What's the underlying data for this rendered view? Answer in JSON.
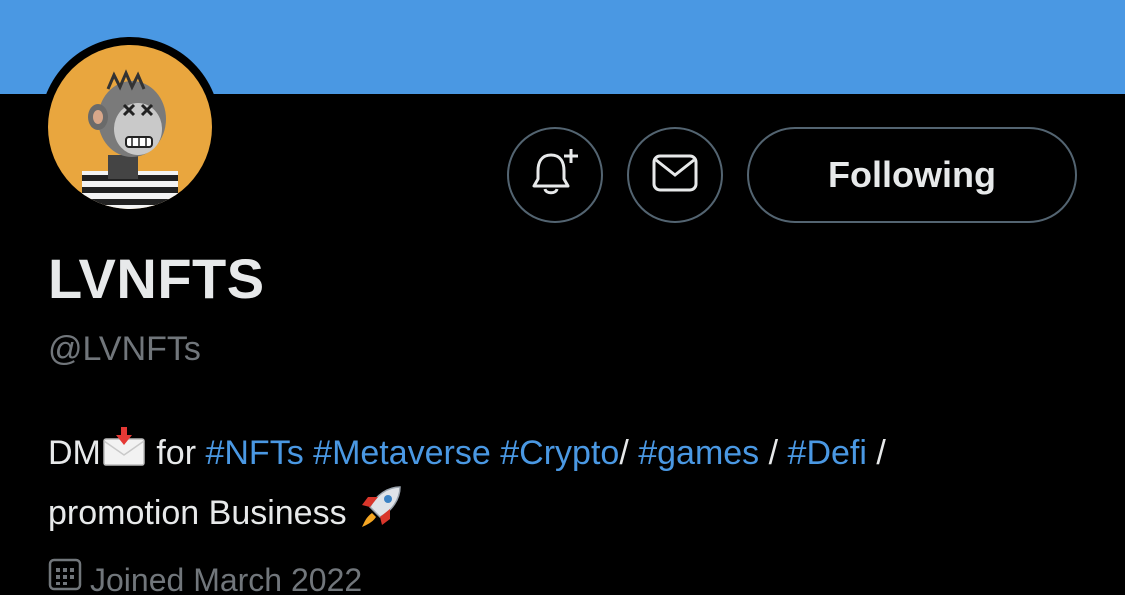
{
  "profile": {
    "display_name": "LVNFTS",
    "handle": "@LVNFTs",
    "follow_label": "Following",
    "joined": "Joined March 2022"
  },
  "bio": {
    "dm": "DM",
    "for": " for ",
    "tags": [
      "#NFTs",
      "#Metaverse",
      "#Crypto",
      "#games",
      "#Defi"
    ],
    "sep1": " ",
    "sep2": " ",
    "sep3": "/ ",
    "sep4": " / ",
    "sep5": " /",
    "line2": "promotion Business "
  },
  "icons": {
    "bell": "bell-plus-icon",
    "mail": "envelope-icon",
    "calendar": "calendar-icon",
    "inbox": "incoming-envelope-emoji",
    "rocket": "rocket-emoji"
  },
  "colors": {
    "banner": "#4a98e3",
    "background": "#000000",
    "link": "#4a98e3",
    "muted": "#71767b",
    "avatar_bg": "#e9a63e"
  }
}
